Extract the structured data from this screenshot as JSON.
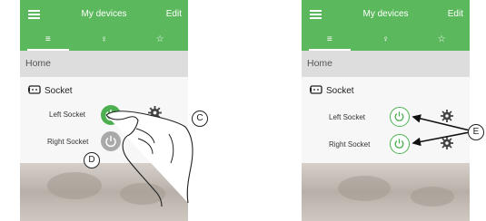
{
  "left_screen": {
    "title": "My devices",
    "edit_label": "Edit",
    "tabs": [
      {
        "icon": "list-icon",
        "glyph": "≡"
      },
      {
        "icon": "bulb-icon",
        "glyph": "♀"
      },
      {
        "icon": "star-icon",
        "glyph": "☆"
      }
    ],
    "room": "Home",
    "device_name": "Socket",
    "items": [
      {
        "label": "Left Socket",
        "state": "on"
      },
      {
        "label": "Right Socket",
        "state": "off"
      }
    ]
  },
  "right_screen": {
    "title": "My devices",
    "edit_label": "Edit",
    "tabs": [
      {
        "icon": "list-icon",
        "glyph": "≡"
      },
      {
        "icon": "bulb-icon",
        "glyph": "♀"
      },
      {
        "icon": "star-icon",
        "glyph": "☆"
      }
    ],
    "room": "Home",
    "device_name": "Socket",
    "items": [
      {
        "label": "Left Socket",
        "state": "outline"
      },
      {
        "label": "Right Socket",
        "state": "outline"
      }
    ]
  },
  "callouts": {
    "c": "C",
    "d": "D",
    "e": "E"
  },
  "colors": {
    "accent": "#5cb85c",
    "on_button": "#4caf50",
    "off_button": "#a9a9a9"
  }
}
